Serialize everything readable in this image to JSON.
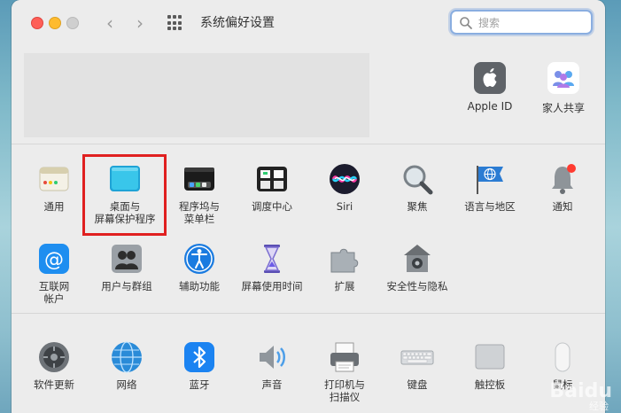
{
  "window": {
    "title": "系统偏好设置"
  },
  "search": {
    "placeholder": "搜索"
  },
  "account": {
    "items": [
      {
        "label": "Apple ID",
        "icon": "apple-id-icon"
      },
      {
        "label": "家人共享",
        "icon": "family-sharing-icon"
      }
    ]
  },
  "section1": {
    "row1": [
      {
        "label": "通用",
        "icon": "general-icon"
      },
      {
        "label": "桌面与\n屏幕保护程序",
        "icon": "desktop-screensaver-icon"
      },
      {
        "label": "程序坞与\n菜单栏",
        "icon": "dock-menubar-icon"
      },
      {
        "label": "调度中心",
        "icon": "mission-control-icon"
      },
      {
        "label": "Siri",
        "icon": "siri-icon"
      },
      {
        "label": "聚焦",
        "icon": "spotlight-icon"
      },
      {
        "label": "语言与地区",
        "icon": "language-region-icon"
      },
      {
        "label": "通知",
        "icon": "notifications-icon"
      }
    ],
    "row2": [
      {
        "label": "互联网\n帐户",
        "icon": "internet-accounts-icon"
      },
      {
        "label": "用户与群组",
        "icon": "users-groups-icon"
      },
      {
        "label": "辅助功能",
        "icon": "accessibility-icon"
      },
      {
        "label": "屏幕使用时间",
        "icon": "screen-time-icon"
      },
      {
        "label": "扩展",
        "icon": "extensions-icon"
      },
      {
        "label": "安全性与隐私",
        "icon": "security-privacy-icon"
      }
    ]
  },
  "section2": {
    "row1": [
      {
        "label": "软件更新",
        "icon": "software-update-icon"
      },
      {
        "label": "网络",
        "icon": "network-icon"
      },
      {
        "label": "蓝牙",
        "icon": "bluetooth-icon"
      },
      {
        "label": "声音",
        "icon": "sound-icon"
      },
      {
        "label": "打印机与\n扫描仪",
        "icon": "printers-scanners-icon"
      },
      {
        "label": "键盘",
        "icon": "keyboard-icon"
      },
      {
        "label": "触控板",
        "icon": "trackpad-icon"
      },
      {
        "label": "鼠标",
        "icon": "mouse-icon"
      }
    ]
  },
  "watermark": {
    "brand": "Baidu",
    "sub": "经验"
  },
  "colors": {
    "highlight": "#e02020",
    "accent": "#8aaee0"
  }
}
